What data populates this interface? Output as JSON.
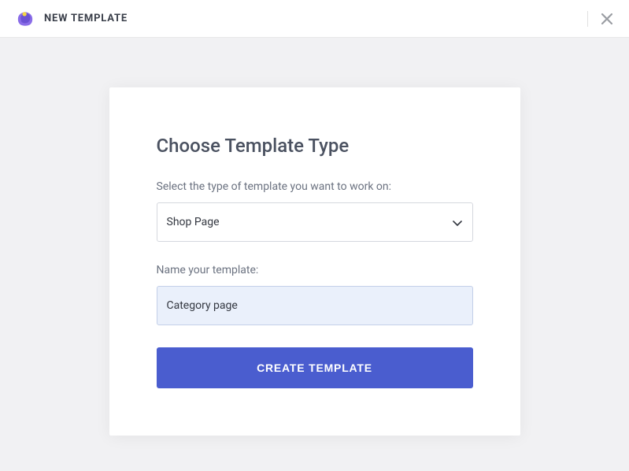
{
  "header": {
    "title": "NEW TEMPLATE"
  },
  "modal": {
    "title": "Choose Template Type",
    "type_label": "Select the type of template you want to work on:",
    "type_value": "Shop Page",
    "name_label": "Name your template:",
    "name_value": "Category page",
    "submit_label": "CREATE TEMPLATE"
  }
}
